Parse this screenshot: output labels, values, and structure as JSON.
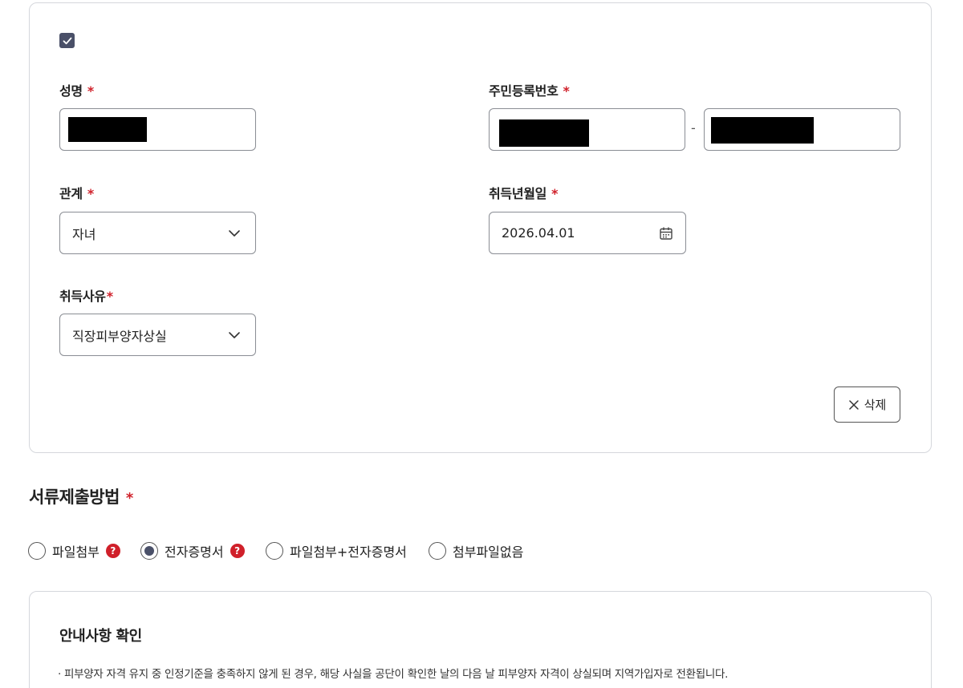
{
  "dependent_form": {
    "fields": {
      "name": {
        "label": "성명",
        "required_mark": "*"
      },
      "resident_number": {
        "label": "주민등록번호",
        "required_mark": "*",
        "separator": "-"
      },
      "relation": {
        "label": "관계",
        "required_mark": "*",
        "value": "자녀"
      },
      "acquired_date": {
        "label": "취득년월일",
        "required_mark": "*",
        "value": "2026.04.01"
      },
      "acquired_reason": {
        "label": "취득사유",
        "required_mark": "*",
        "value": "직장피부양자상실"
      }
    },
    "delete_label": "삭제"
  },
  "submission": {
    "title": "서류제출방법",
    "required_mark": "*",
    "help_glyph": "?",
    "options": [
      {
        "label": "파일첨부",
        "help": true,
        "selected": false
      },
      {
        "label": "전자증명서",
        "help": true,
        "selected": true
      },
      {
        "label": "파일첨부+전자증명서",
        "help": false,
        "selected": false
      },
      {
        "label": "첨부파일없음",
        "help": false,
        "selected": false
      }
    ]
  },
  "notice": {
    "title": "안내사항 확인",
    "items": [
      "· 피부양자 자격 유지 중 인정기준을 충족하지 않게 된 경우, 해당 사실을 공단이 확인한 날의 다음 날 피부양자 자격이 상실되며 지역가입자로 전환됩니다."
    ]
  },
  "colors": {
    "accent": "#4a5068",
    "required": "#d0202a",
    "border": "#8a8d94"
  },
  "icons": [
    "checkbox-checked-icon",
    "chevron-down-icon",
    "calendar-icon",
    "close-icon",
    "help-icon"
  ]
}
